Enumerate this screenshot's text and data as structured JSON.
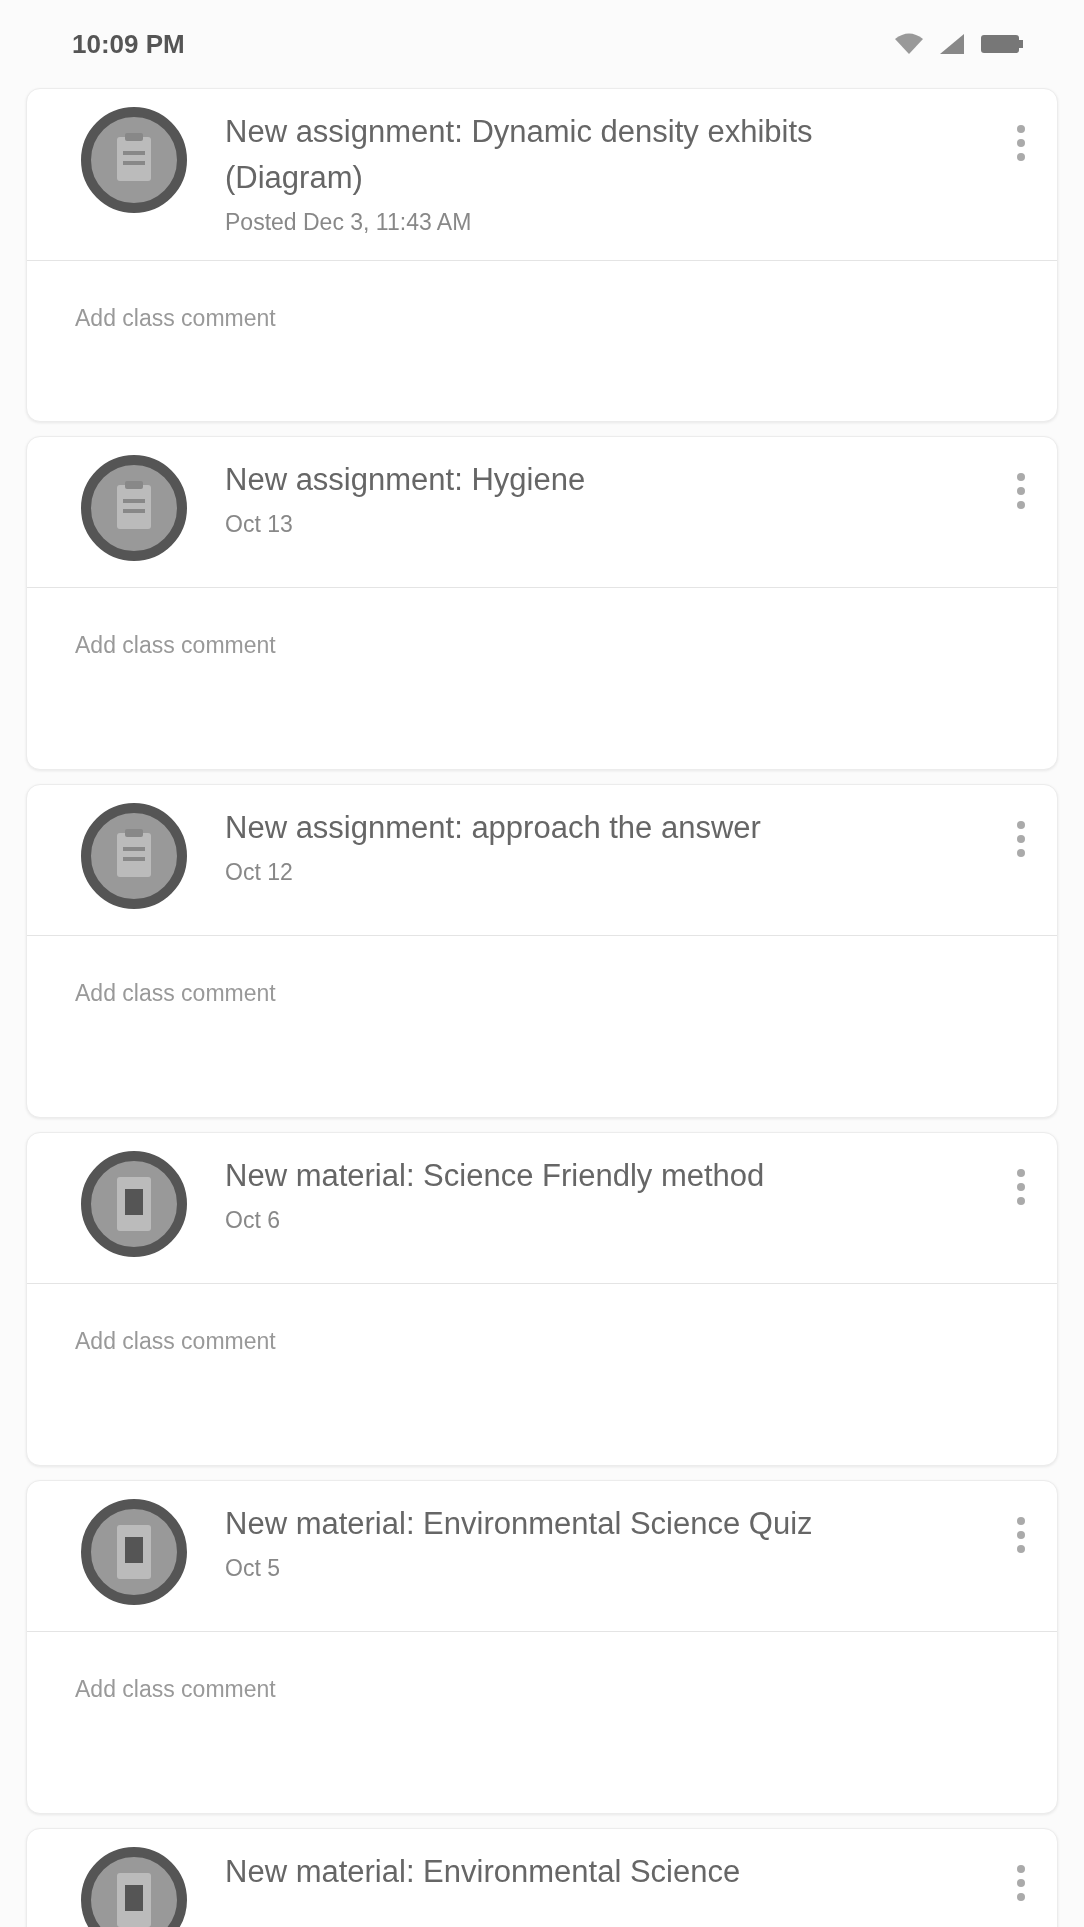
{
  "status_bar": {
    "time": "10:09 PM"
  },
  "stream": [
    {
      "kind": "assignment",
      "title": "New assignment: Dynamic density exhibits (Diagram)",
      "time": "Posted Dec 3, 11:43 AM",
      "comment_placeholder": "Add class comment"
    },
    {
      "kind": "assignment",
      "title": "New assignment: Hygiene",
      "time": "Oct 13",
      "comment_placeholder": "Add class comment"
    },
    {
      "kind": "assignment",
      "title": "New assignment: approach the answer",
      "time": "Oct 12",
      "comment_placeholder": "Add class comment"
    },
    {
      "kind": "material",
      "title": "New material: Science Friendly method",
      "time": "Oct 6",
      "comment_placeholder": "Add class comment"
    },
    {
      "kind": "material",
      "title": "New material: Environmental Science Quiz",
      "time": "Oct 5",
      "comment_placeholder": "Add class comment"
    },
    {
      "kind": "material",
      "title": "New material: Environmental Science"
    }
  ]
}
